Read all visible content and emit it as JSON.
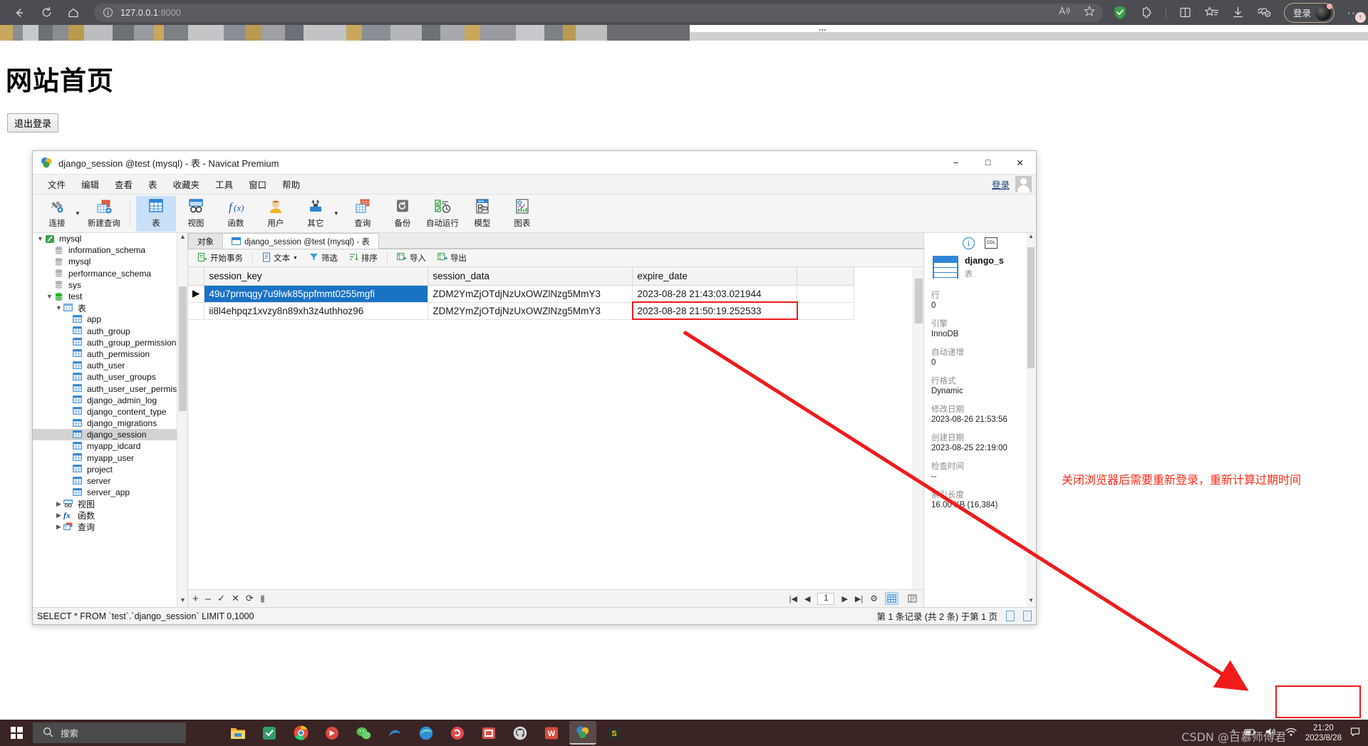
{
  "browser": {
    "url_host": "127.0.0.1",
    "url_port": ":8000",
    "back_icon": "back-arrow-icon",
    "reload_icon": "reload-icon",
    "home_icon": "home-icon",
    "info_icon": "site-info-icon",
    "read_aloud_icon": "read-aloud-icon",
    "favorite_icon": "star-icon",
    "shield_icon": "adblock-shield-icon",
    "extensions_icon": "extensions-icon",
    "split_icon": "split-screen-icon",
    "collections_icon": "collections-icon",
    "downloads_icon": "downloads-icon",
    "performance_icon": "browser-essentials-icon",
    "login_label": "登录",
    "more_label": "···"
  },
  "page": {
    "title": "网站首页",
    "logout_button": "退出登录"
  },
  "navicat": {
    "title": "django_session @test (mysql) - 表 - Navicat Premium",
    "window_buttons": {
      "minimize": "–",
      "maximize": "□",
      "close": "✕"
    },
    "menu": [
      "文件",
      "编辑",
      "查看",
      "表",
      "收藏夹",
      "工具",
      "窗口",
      "帮助"
    ],
    "menu_login": "登录",
    "toolbar": [
      {
        "label": "连接",
        "icon": "connection-icon",
        "caret": true,
        "active": false
      },
      {
        "label": "新建查询",
        "icon": "new-query-icon",
        "caret": false,
        "active": false
      },
      {
        "label": "表",
        "icon": "table-icon",
        "caret": false,
        "active": true
      },
      {
        "label": "视图",
        "icon": "view-icon",
        "caret": false,
        "active": false
      },
      {
        "label": "函数",
        "icon": "function-icon",
        "caret": false,
        "active": false
      },
      {
        "label": "用户",
        "icon": "user-icon",
        "caret": false,
        "active": false
      },
      {
        "label": "其它",
        "icon": "others-icon",
        "caret": true,
        "active": false
      },
      {
        "label": "查询",
        "icon": "query-icon",
        "caret": false,
        "active": false
      },
      {
        "label": "备份",
        "icon": "backup-icon",
        "caret": false,
        "active": false
      },
      {
        "label": "自动运行",
        "icon": "automation-icon",
        "caret": false,
        "active": false
      },
      {
        "label": "模型",
        "icon": "model-icon",
        "caret": false,
        "active": false
      },
      {
        "label": "图表",
        "icon": "chart-icon",
        "caret": false,
        "active": false
      }
    ],
    "tree": [
      {
        "label": "mysql",
        "depth": 0,
        "twisty": "v",
        "icon": "connection-icon",
        "selected": false
      },
      {
        "label": "information_schema",
        "depth": 1,
        "twisty": "",
        "icon": "database-icon",
        "selected": false
      },
      {
        "label": "mysql",
        "depth": 1,
        "twisty": "",
        "icon": "database-icon",
        "selected": false
      },
      {
        "label": "performance_schema",
        "depth": 1,
        "twisty": "",
        "icon": "database-icon",
        "selected": false
      },
      {
        "label": "sys",
        "depth": 1,
        "twisty": "",
        "icon": "database-icon",
        "selected": false
      },
      {
        "label": "test",
        "depth": 1,
        "twisty": "v",
        "icon": "database-open-icon",
        "selected": false
      },
      {
        "label": "表",
        "depth": 2,
        "twisty": "v",
        "icon": "table-folder-icon",
        "selected": false
      },
      {
        "label": "app",
        "depth": 3,
        "twisty": "",
        "icon": "table-icon",
        "selected": false
      },
      {
        "label": "auth_group",
        "depth": 3,
        "twisty": "",
        "icon": "table-icon",
        "selected": false
      },
      {
        "label": "auth_group_permissions",
        "depth": 3,
        "twisty": "",
        "icon": "table-icon",
        "selected": false
      },
      {
        "label": "auth_permission",
        "depth": 3,
        "twisty": "",
        "icon": "table-icon",
        "selected": false
      },
      {
        "label": "auth_user",
        "depth": 3,
        "twisty": "",
        "icon": "table-icon",
        "selected": false
      },
      {
        "label": "auth_user_groups",
        "depth": 3,
        "twisty": "",
        "icon": "table-icon",
        "selected": false
      },
      {
        "label": "auth_user_user_permissions",
        "depth": 3,
        "twisty": "",
        "icon": "table-icon",
        "selected": false
      },
      {
        "label": "django_admin_log",
        "depth": 3,
        "twisty": "",
        "icon": "table-icon",
        "selected": false
      },
      {
        "label": "django_content_type",
        "depth": 3,
        "twisty": "",
        "icon": "table-icon",
        "selected": false
      },
      {
        "label": "django_migrations",
        "depth": 3,
        "twisty": "",
        "icon": "table-icon",
        "selected": false
      },
      {
        "label": "django_session",
        "depth": 3,
        "twisty": "",
        "icon": "table-icon",
        "selected": true
      },
      {
        "label": "myapp_idcard",
        "depth": 3,
        "twisty": "",
        "icon": "table-icon",
        "selected": false
      },
      {
        "label": "myapp_user",
        "depth": 3,
        "twisty": "",
        "icon": "table-icon",
        "selected": false
      },
      {
        "label": "project",
        "depth": 3,
        "twisty": "",
        "icon": "table-icon",
        "selected": false
      },
      {
        "label": "server",
        "depth": 3,
        "twisty": "",
        "icon": "table-icon",
        "selected": false
      },
      {
        "label": "server_app",
        "depth": 3,
        "twisty": "",
        "icon": "table-icon",
        "selected": false
      },
      {
        "label": "视图",
        "depth": 2,
        "twisty": ">",
        "icon": "view-icon",
        "selected": false
      },
      {
        "label": "函数",
        "depth": 2,
        "twisty": ">",
        "icon": "function-icon",
        "selected": false
      },
      {
        "label": "查询",
        "depth": 2,
        "twisty": ">",
        "icon": "query-icon",
        "selected": false
      }
    ],
    "tabs": [
      {
        "label": "对象",
        "active": false,
        "icon": ""
      },
      {
        "label": "django_session @test (mysql) - 表",
        "active": true,
        "icon": "table-icon"
      }
    ],
    "grid_tools": [
      {
        "label": "开始事务",
        "icon": "transaction-icon",
        "caret": false
      },
      {
        "label": "文本",
        "icon": "text-icon",
        "caret": true
      },
      {
        "label": "筛选",
        "icon": "filter-icon",
        "caret": false
      },
      {
        "label": "排序",
        "icon": "sort-icon",
        "caret": false
      },
      {
        "label": "导入",
        "icon": "import-icon",
        "caret": false
      },
      {
        "label": "导出",
        "icon": "export-icon",
        "caret": false
      }
    ],
    "grid": {
      "columns": [
        "session_key",
        "session_data",
        "expire_date"
      ],
      "rows": [
        {
          "selected": true,
          "marker": "▶",
          "cells": [
            "49u7prmqgy7u9lwk85ppfmmt0255mgfi",
            "ZDM2YmZjOTdjNzUxOWZlNzg5MmY3",
            "2023-08-28 21:43:03.021944"
          ],
          "highlight": [
            false,
            false,
            false
          ]
        },
        {
          "selected": false,
          "marker": "",
          "cells": [
            "ii8l4ehpqz1xvzy8n89xh3z4uthhoz96",
            "ZDM2YmZjOTdjNzUxOWZlNzg5MmY3",
            "2023-08-28 21:50:19.252533"
          ],
          "highlight": [
            false,
            false,
            true
          ]
        }
      ]
    },
    "grid_footer": {
      "buttons": [
        "+",
        "–",
        "✓",
        "✕",
        "⟳",
        "▮"
      ],
      "page_number": "1",
      "nav": [
        "|◀",
        "◀",
        "▶",
        "▶|",
        "⚙"
      ],
      "view_grid_icon": "grid-view-icon",
      "view_form_icon": "form-view-icon"
    },
    "info_panel": {
      "object_name": "django_s",
      "object_type": "表",
      "fields": [
        {
          "label": "行",
          "value": "0"
        },
        {
          "label": "引擎",
          "value": "InnoDB"
        },
        {
          "label": "自动递增",
          "value": "0"
        },
        {
          "label": "行格式",
          "value": "Dynamic"
        },
        {
          "label": "修改日期",
          "value": "2023-08-26 21:53:56"
        },
        {
          "label": "创建日期",
          "value": "2023-08-25 22:19:00"
        },
        {
          "label": "检查时间",
          "value": "--"
        },
        {
          "label": "索引长度",
          "value": "16.00 KB (16,384)"
        }
      ],
      "info_icon": "info-icon",
      "ddl_icon": "ddl-icon"
    },
    "status_bar": {
      "sql": "SELECT * FROM `test`.`django_session` LIMIT 0,1000",
      "record_info": "第 1 条记录 (共 2 条) 于第 1 页"
    }
  },
  "annotation": {
    "note": "关闭浏览器后需要重新登录，重新计算过期时间",
    "color": "#ff2a15"
  },
  "taskbar": {
    "start_icon": "windows-start-icon",
    "search_placeholder": "搜索",
    "search_icon": "search-icon",
    "apps": [
      {
        "name": "file-explorer-icon",
        "active": false
      },
      {
        "name": "app-green-icon",
        "active": false
      },
      {
        "name": "chrome-icon",
        "active": false
      },
      {
        "name": "app-red-icon",
        "active": false
      },
      {
        "name": "wechat-icon",
        "active": false
      },
      {
        "name": "app-blue-icon",
        "active": false
      },
      {
        "name": "edge-icon",
        "active": false
      },
      {
        "name": "app-pink-icon",
        "active": false
      },
      {
        "name": "app-orange-icon",
        "active": false
      },
      {
        "name": "github-icon",
        "active": false
      },
      {
        "name": "wps-icon",
        "active": false
      },
      {
        "name": "navicat-icon",
        "active": true
      },
      {
        "name": "app-yellow-icon",
        "active": false
      }
    ],
    "tray": [
      "^",
      "battery-icon",
      "volume-icon",
      "wifi-icon"
    ],
    "clock_time": "21:20",
    "clock_date": "2023/8/28",
    "watermark": "CSDN @百慕师傅君"
  }
}
